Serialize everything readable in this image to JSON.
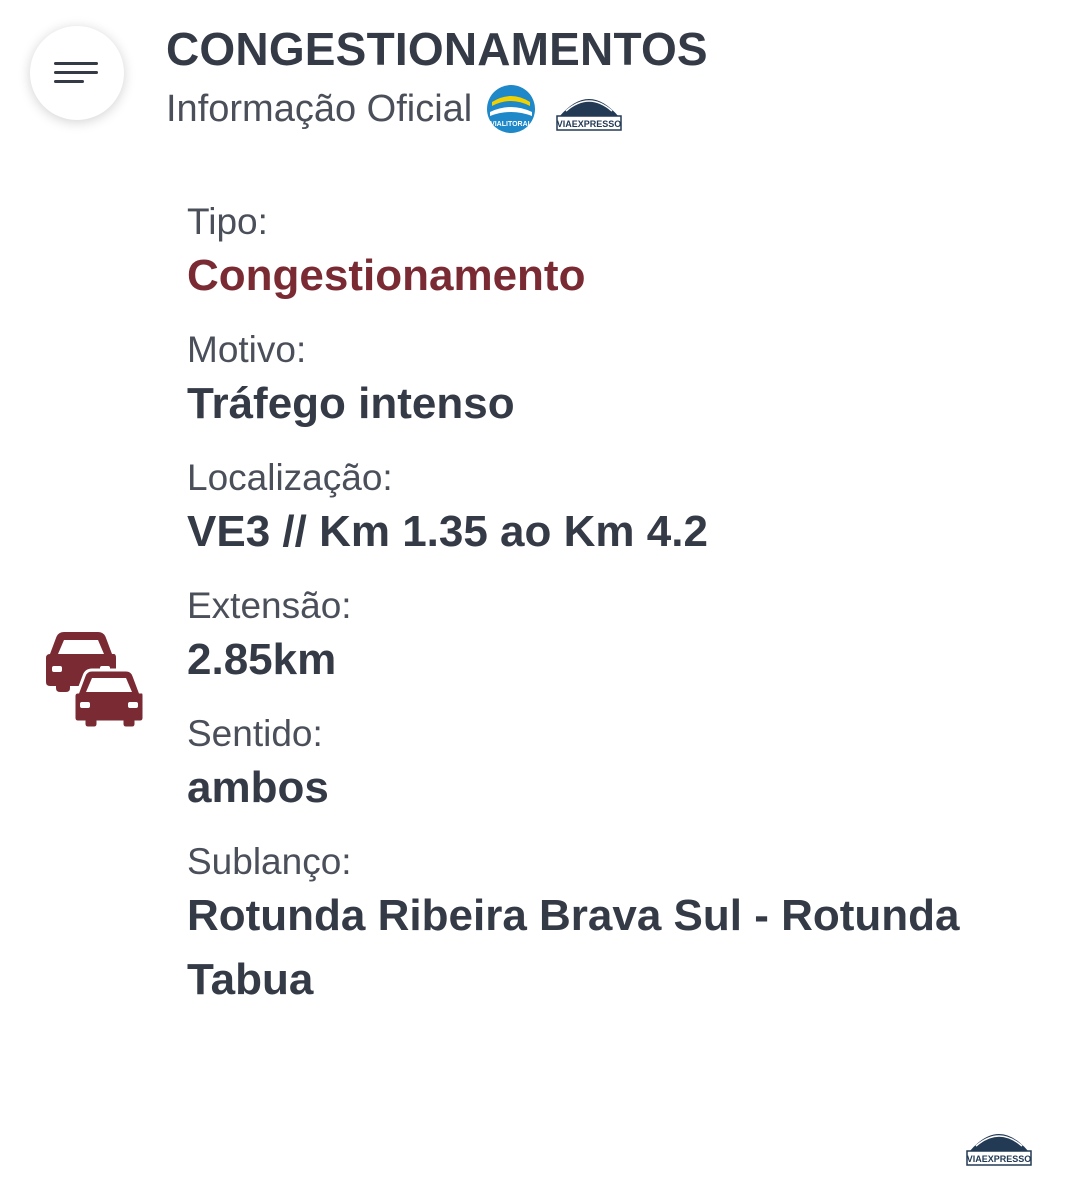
{
  "header": {
    "menu_icon": "hamburger-menu-icon",
    "title": "CONGESTIONAMENTOS",
    "subtitle": "Informação Oficial",
    "logos": [
      {
        "name": "vialitoral-logo",
        "text": "VIALITORAL",
        "color": "#1e88c9"
      },
      {
        "name": "viaexpresso-logo",
        "text": "VIAEXPRESSO",
        "color": "#233a55"
      }
    ]
  },
  "details": {
    "tipo_label": "Tipo:",
    "tipo_value": "Congestionamento",
    "motivo_label": "Motivo:",
    "motivo_value": "Tráfego intenso",
    "localizacao_label": "Localização:",
    "localizacao_value": "VE3 // Km 1.35 ao Km 4.2",
    "extensao_label": "Extensão:",
    "extensao_value": "2.85km",
    "sentido_label": "Sentido:",
    "sentido_value": "ambos",
    "sublanco_label": "Sublanço:",
    "sublanco_value": "Rotunda Ribeira Brava Sul - Rotunda Tabua"
  },
  "icons": {
    "traffic": "cars-traffic-icon"
  },
  "footer": {
    "logo_text": "VIAEXPRESSO"
  },
  "colors": {
    "accent": "#7a2a32",
    "text": "#343a46",
    "label": "#4a4f5a"
  }
}
